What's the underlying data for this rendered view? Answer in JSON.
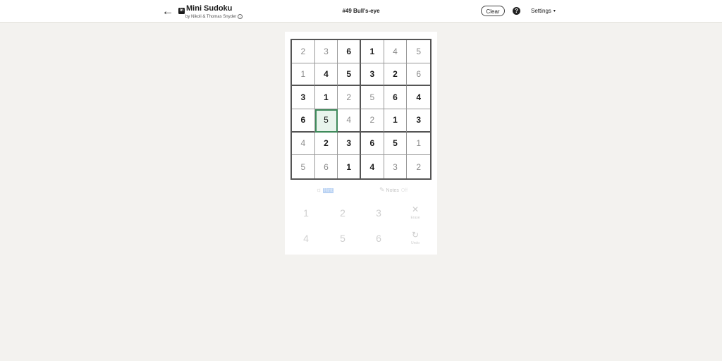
{
  "header": {
    "back_icon": "←",
    "logo_text": "in",
    "title": "Mini Sudoku",
    "byline": "by Nikoli & Thomas Snyder",
    "info_icon": "i",
    "puzzle_name": "#49 Bull's-eye",
    "clear_label": "Clear",
    "help_icon": "?",
    "settings_label": "Settings",
    "settings_caret": "▾"
  },
  "board": {
    "rows": [
      [
        {
          "v": "2",
          "t": "filled"
        },
        {
          "v": "3",
          "t": "filled"
        },
        {
          "v": "6",
          "t": "given"
        },
        {
          "v": "1",
          "t": "given"
        },
        {
          "v": "4",
          "t": "filled"
        },
        {
          "v": "5",
          "t": "filled"
        }
      ],
      [
        {
          "v": "1",
          "t": "filled"
        },
        {
          "v": "4",
          "t": "given"
        },
        {
          "v": "5",
          "t": "given"
        },
        {
          "v": "3",
          "t": "given"
        },
        {
          "v": "2",
          "t": "given"
        },
        {
          "v": "6",
          "t": "filled"
        }
      ],
      [
        {
          "v": "3",
          "t": "given"
        },
        {
          "v": "1",
          "t": "given"
        },
        {
          "v": "2",
          "t": "filled"
        },
        {
          "v": "5",
          "t": "filled"
        },
        {
          "v": "6",
          "t": "given"
        },
        {
          "v": "4",
          "t": "given"
        }
      ],
      [
        {
          "v": "6",
          "t": "given"
        },
        {
          "v": "5",
          "t": "selected"
        },
        {
          "v": "4",
          "t": "filled"
        },
        {
          "v": "2",
          "t": "filled"
        },
        {
          "v": "1",
          "t": "given"
        },
        {
          "v": "3",
          "t": "given"
        }
      ],
      [
        {
          "v": "4",
          "t": "filled"
        },
        {
          "v": "2",
          "t": "given"
        },
        {
          "v": "3",
          "t": "given"
        },
        {
          "v": "6",
          "t": "given"
        },
        {
          "v": "5",
          "t": "given"
        },
        {
          "v": "1",
          "t": "filled"
        }
      ],
      [
        {
          "v": "5",
          "t": "filled"
        },
        {
          "v": "6",
          "t": "filled"
        },
        {
          "v": "1",
          "t": "given"
        },
        {
          "v": "4",
          "t": "given"
        },
        {
          "v": "3",
          "t": "filled"
        },
        {
          "v": "2",
          "t": "filled"
        }
      ]
    ],
    "selected_cell": {
      "row": 4,
      "col": 2
    },
    "colors": {
      "given": "#1a1a1a",
      "filled": "#8c8c8c",
      "selected_border": "#3f8a5b",
      "selected_fill": "#e8f4ec"
    }
  },
  "controls": {
    "hint_icon": "☼",
    "hint_label": "Hint",
    "notes_icon": "✎",
    "notes_label": "Notes",
    "notes_state": "Off"
  },
  "keypad": {
    "row1": [
      "1",
      "2",
      "3"
    ],
    "row2": [
      "4",
      "5",
      "6"
    ],
    "erase": {
      "icon": "✕",
      "label": "Erase"
    },
    "undo": {
      "icon": "↻",
      "label": "Undo"
    }
  }
}
